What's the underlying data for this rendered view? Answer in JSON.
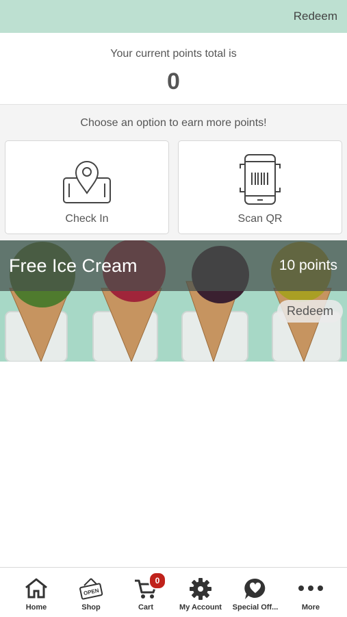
{
  "header": {
    "redeem_label": "Redeem"
  },
  "points": {
    "label": "Your current points total is",
    "value": "0"
  },
  "earn": {
    "prompt": "Choose an option to earn more points!",
    "options": [
      {
        "label": "Check In",
        "icon": "phone-location-pin-icon"
      },
      {
        "label": "Scan QR",
        "icon": "phone-barcode-scan-icon"
      }
    ]
  },
  "reward": {
    "title": "Free Ice Cream",
    "points": "10 points",
    "redeem_label": "Redeem"
  },
  "tabs": [
    {
      "label": "Home",
      "icon": "home-icon"
    },
    {
      "label": "Shop",
      "icon": "open-sign-icon"
    },
    {
      "label": "Cart",
      "icon": "cart-icon",
      "badge": "0"
    },
    {
      "label": "My Account",
      "icon": "gear-icon"
    },
    {
      "label": "Special Off...",
      "icon": "heart-bubble-icon"
    },
    {
      "label": "More",
      "icon": "more-dots-icon"
    }
  ],
  "colors": {
    "header_bg": "#bde0d1",
    "badge": "#c0221b",
    "promo_bg": "#a7d8c6"
  }
}
